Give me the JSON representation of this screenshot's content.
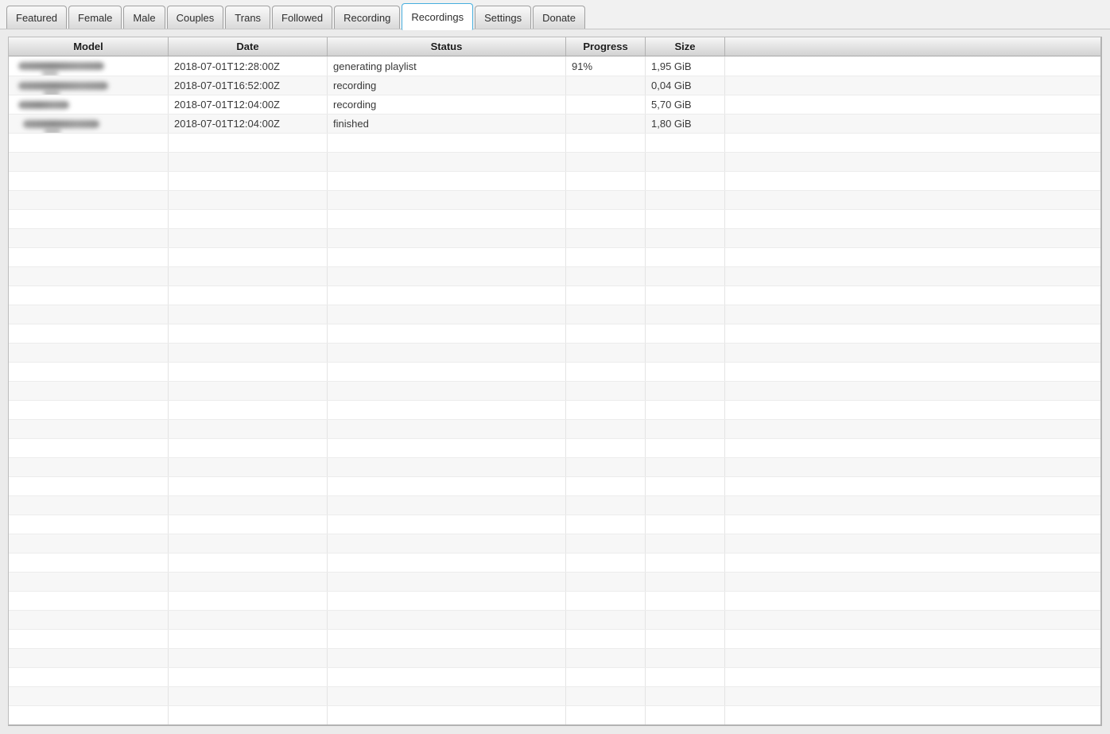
{
  "colors": {
    "active_tab_border": "#47aede"
  },
  "tabs": {
    "items": [
      {
        "label": "Featured",
        "active": false
      },
      {
        "label": "Female",
        "active": false
      },
      {
        "label": "Male",
        "active": false
      },
      {
        "label": "Couples",
        "active": false
      },
      {
        "label": "Trans",
        "active": false
      },
      {
        "label": "Followed",
        "active": false
      },
      {
        "label": "Recording",
        "active": false
      },
      {
        "label": "Recordings",
        "active": true
      },
      {
        "label": "Settings",
        "active": false
      },
      {
        "label": "Donate",
        "active": false
      }
    ]
  },
  "table": {
    "columns": {
      "model": "Model",
      "date": "Date",
      "status": "Status",
      "progress": "Progress",
      "size": "Size"
    },
    "rows": [
      {
        "model_redacted": true,
        "date": "2018-07-01T12:28:00Z",
        "status": "generating playlist",
        "progress": "91%",
        "size": "1,95 GiB"
      },
      {
        "model_redacted": true,
        "date": "2018-07-01T16:52:00Z",
        "status": "recording",
        "progress": "",
        "size": "0,04 GiB"
      },
      {
        "model_redacted": true,
        "date": "2018-07-01T12:04:00Z",
        "status": "recording",
        "progress": "",
        "size": "5,70 GiB"
      },
      {
        "model_redacted": true,
        "date": "2018-07-01T12:04:00Z",
        "status": "finished",
        "progress": "",
        "size": "1,80 GiB"
      }
    ],
    "empty_row_count": 31
  }
}
